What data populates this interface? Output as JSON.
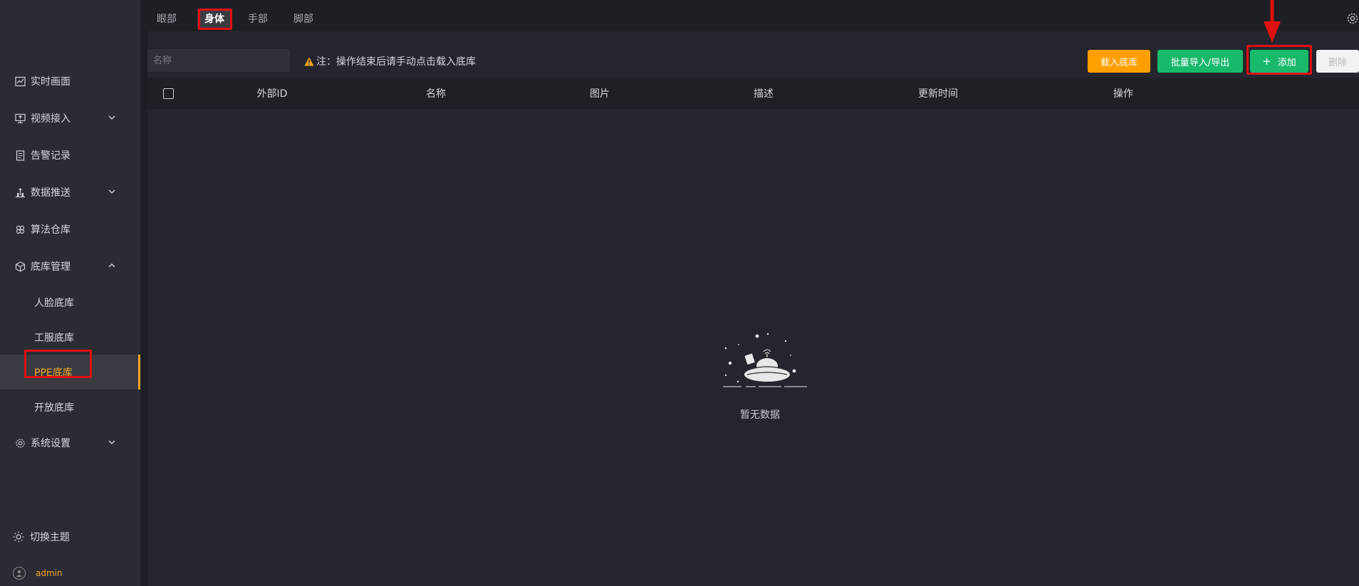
{
  "sidebar": {
    "items": [
      {
        "label": "实时画面",
        "icon": "chart-line-icon"
      },
      {
        "label": "视频接入",
        "icon": "monitor-icon"
      },
      {
        "label": "告警记录",
        "icon": "document-icon"
      },
      {
        "label": "数据推送",
        "icon": "upload-bar-icon"
      },
      {
        "label": "算法仓库",
        "icon": "algorithm-icon"
      },
      {
        "label": "底库管理",
        "icon": "cube-icon"
      }
    ],
    "subitems": [
      "人脸底库",
      "工服底库",
      "PPE底库",
      "开放底库"
    ],
    "settings_label": "系统设置",
    "theme_label": "切换主题",
    "user": "admin"
  },
  "tabs": [
    "眼部",
    "身体",
    "手部",
    "脚部"
  ],
  "active_tab": "身体",
  "search": {
    "placeholder": "名称"
  },
  "note": "注：操作结束后请手动点击载入底库",
  "buttons": {
    "load": "载入底库",
    "batch": "批量导入/导出",
    "add": "添加",
    "add_prefix": "+",
    "delete": "删除"
  },
  "table": {
    "columns": [
      "外部ID",
      "名称",
      "图片",
      "描述",
      "更新时间",
      "操作"
    ]
  },
  "empty_text": "暂无数据",
  "colors": {
    "accent": "#f5a623",
    "primary_green": "#19b96b",
    "orange": "#ff9f00",
    "highlight_red": "#e01010"
  }
}
